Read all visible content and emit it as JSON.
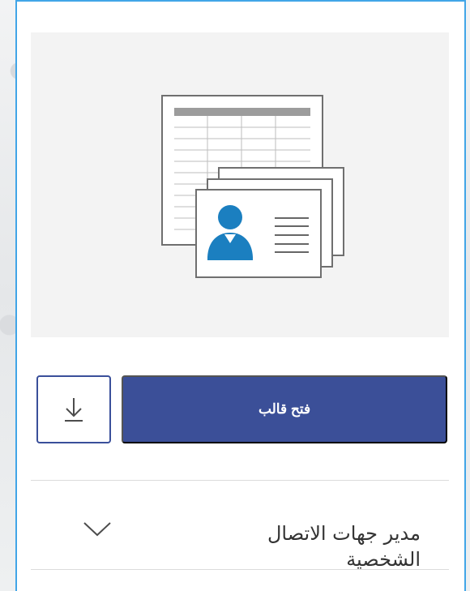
{
  "template_card": {
    "preview_icon": "contact-manager-template-icon",
    "actions": {
      "download_icon": "download-icon",
      "open_label": "فتح قالب"
    },
    "title": "مدير جهات الاتصال الشخصية",
    "expand_icon": "chevron-down-icon"
  },
  "colors": {
    "card_border": "#41a5e7",
    "primary": "#3b4f98",
    "preview_bg": "#f3f3f3",
    "contact_blue": "#1b7fc0",
    "line_gray": "#666666"
  }
}
